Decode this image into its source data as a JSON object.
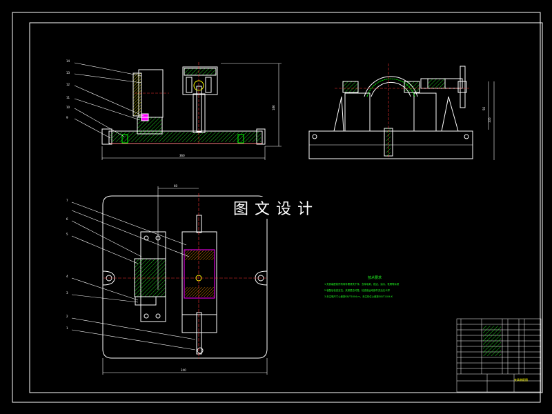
{
  "watermark": "图文设计",
  "technical_requirements": {
    "title": "技术要求",
    "lines": [
      "1.夹具装配前所有零件需清洗干净，去除毛刺、锐边、油污、铁屑等杂质",
      "2.装配后检查定位、夹紧是否可靠，检查各运动部件灵活无卡滞",
      "3.未注明尺寸公差按GB/T1804-m，未注形位公差按GB/T1184-K"
    ]
  },
  "balloons_front": [
    "14",
    "13",
    "12",
    "11",
    "10",
    "9"
  ],
  "balloons_top": [
    "7",
    "6",
    "5",
    "4",
    "3",
    "2",
    "1"
  ],
  "title_block_label": "夹具装配图",
  "colors": {
    "outline": "#ffffff",
    "part": "#ffffff",
    "dimension": "#22ff22",
    "hatch": "#22ff22",
    "center": "#ff3333",
    "accent": "#ff00ff",
    "cyan": "#00ffff",
    "yellow": "#ffff00"
  }
}
